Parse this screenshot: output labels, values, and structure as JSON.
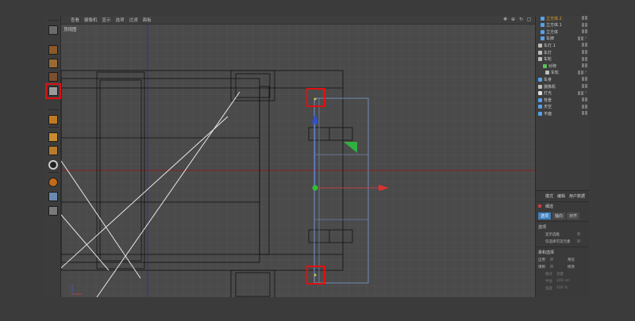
{
  "viewport": {
    "menu": [
      "查看",
      "摄像机",
      "显示",
      "选项",
      "过滤",
      "面板"
    ],
    "label": "顶视图",
    "icons": [
      "move-view-icon",
      "zoom-view-icon",
      "rotate-view-icon",
      "maximize-view-icon"
    ]
  },
  "toolbar": {
    "tools": [
      {
        "name": "cube-tool-1",
        "color": "#8a5a2c"
      },
      {
        "name": "checker-tool",
        "color": "#9a6a34"
      },
      {
        "name": "layer-tool",
        "color": "#7a5030"
      },
      {
        "name": "cube-tool-selected",
        "color": "#9a9a9a"
      },
      {
        "name": "cube-tool-orange",
        "color": "#c07a20"
      },
      {
        "name": "floor-tool",
        "color": "#c98a30"
      },
      {
        "name": "spline-tool",
        "color": "#b87b2c"
      },
      {
        "name": "s-tool",
        "color": "#bdbdbd"
      },
      {
        "name": "magnet-tool",
        "color": "#c06a1a"
      },
      {
        "name": "lock-grid-tool",
        "color": "#6a8ab0"
      },
      {
        "name": "grid-tool",
        "color": "#7a7a7a"
      }
    ]
  },
  "objects": [
    {
      "name": "立方体.2",
      "icon": "#58a0e8",
      "indent": 6
    },
    {
      "name": "立方体.1",
      "icon": "#58a0e8",
      "indent": 6
    },
    {
      "name": "立方体",
      "icon": "#58a0e8",
      "indent": 6
    },
    {
      "name": "车牌",
      "icon": "#58a0e8",
      "indent": 6
    },
    {
      "name": "车灯.1",
      "icon": "#bdbdbd",
      "indent": 3
    },
    {
      "name": "车灯",
      "icon": "#bdbdbd",
      "indent": 3
    },
    {
      "name": "车轮",
      "icon": "#bdbdbd",
      "indent": 3
    },
    {
      "name": "对称",
      "icon": "#58c058",
      "indent": 9
    },
    {
      "name": "车轮",
      "icon": "#bdbdbd",
      "indent": 12
    },
    {
      "name": "车身",
      "icon": "#58a0e8",
      "indent": 3
    },
    {
      "name": "摄像机",
      "icon": "#bdbdbd",
      "indent": 3
    },
    {
      "name": "灯光",
      "icon": "#e0e0e0",
      "indent": 3
    },
    {
      "name": "背景",
      "icon": "#58a0e8",
      "indent": 3
    },
    {
      "name": "天空",
      "icon": "#58a0e8",
      "indent": 3
    },
    {
      "name": "平面",
      "icon": "#58a0e8",
      "indent": 3
    }
  ],
  "attributes": {
    "tabs": [
      "模式",
      "编辑",
      "用户数据"
    ],
    "title": "细选",
    "subtabs": [
      "选项",
      "轴向",
      "对齐"
    ],
    "section1": "选项",
    "field1": "显示选框",
    "field2": "仅选择可见元素",
    "section2": "柔和选择",
    "row1_left": "启用",
    "row1_right": "预览",
    "row2_left": "限制",
    "row2_right": "修改",
    "row3_label": "模式",
    "row3_value": "测量",
    "row4_label": "半径",
    "row4_value": "100 cm",
    "row5_label": "强度",
    "row5_value": "100 %"
  }
}
